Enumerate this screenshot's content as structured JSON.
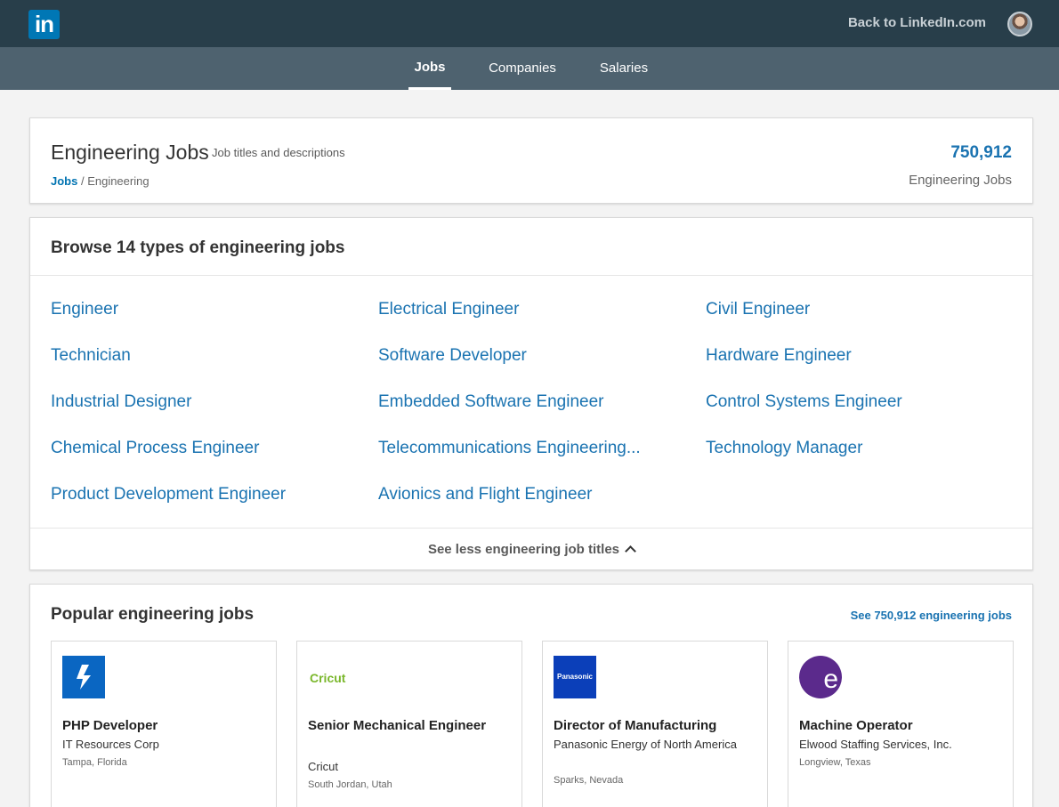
{
  "topbar": {
    "logo_text": "in",
    "back_link": "Back to LinkedIn.com"
  },
  "subnav": {
    "tabs": [
      {
        "label": "Jobs",
        "active": true
      },
      {
        "label": "Companies",
        "active": false
      },
      {
        "label": "Salaries",
        "active": false
      }
    ]
  },
  "header": {
    "title": "Engineering Jobs",
    "subtitle": "Job titles and descriptions",
    "breadcrumb_root": "Jobs",
    "breadcrumb_sep": " / ",
    "breadcrumb_current": "Engineering",
    "count": "750,912",
    "count_label": "Engineering Jobs"
  },
  "browse": {
    "title": "Browse 14 types of engineering jobs",
    "columns": [
      [
        "Engineer",
        "Technician",
        "Industrial Designer",
        "Chemical Process Engineer",
        "Product Development Engineer"
      ],
      [
        "Electrical Engineer",
        "Software Developer",
        "Embedded Software Engineer",
        "Telecommunications Engineering...",
        "Avionics and Flight Engineer"
      ],
      [
        "Civil Engineer",
        "Hardware Engineer",
        "Control Systems Engineer",
        "Technology Manager"
      ]
    ],
    "see_less": "See less engineering job titles"
  },
  "popular": {
    "title": "Popular engineering jobs",
    "see_all": "See 750,912 engineering jobs",
    "jobs": [
      {
        "title": "PHP Developer",
        "company": "IT Resources Corp",
        "location": "Tampa, Florida",
        "logo_icon": "it-resources-logo"
      },
      {
        "title": "Senior Mechanical Engineer",
        "company": "Cricut",
        "location": "South Jordan, Utah",
        "logo_icon": "cricut-logo",
        "logo_text": "Cricut"
      },
      {
        "title": "Director of Manufacturing",
        "company": "Panasonic Energy of North America",
        "location": "Sparks, Nevada",
        "logo_icon": "panasonic-logo",
        "logo_text": "Panasonic"
      },
      {
        "title": "Machine Operator",
        "company": "Elwood Staffing Services, Inc.",
        "location": "Longview, Texas",
        "logo_icon": "elwood-logo",
        "logo_text": "e"
      }
    ]
  },
  "colors": {
    "topbar": "#283e4a",
    "subnav": "#4e626f",
    "link": "#1a73b1",
    "brand": "#0077b5"
  }
}
